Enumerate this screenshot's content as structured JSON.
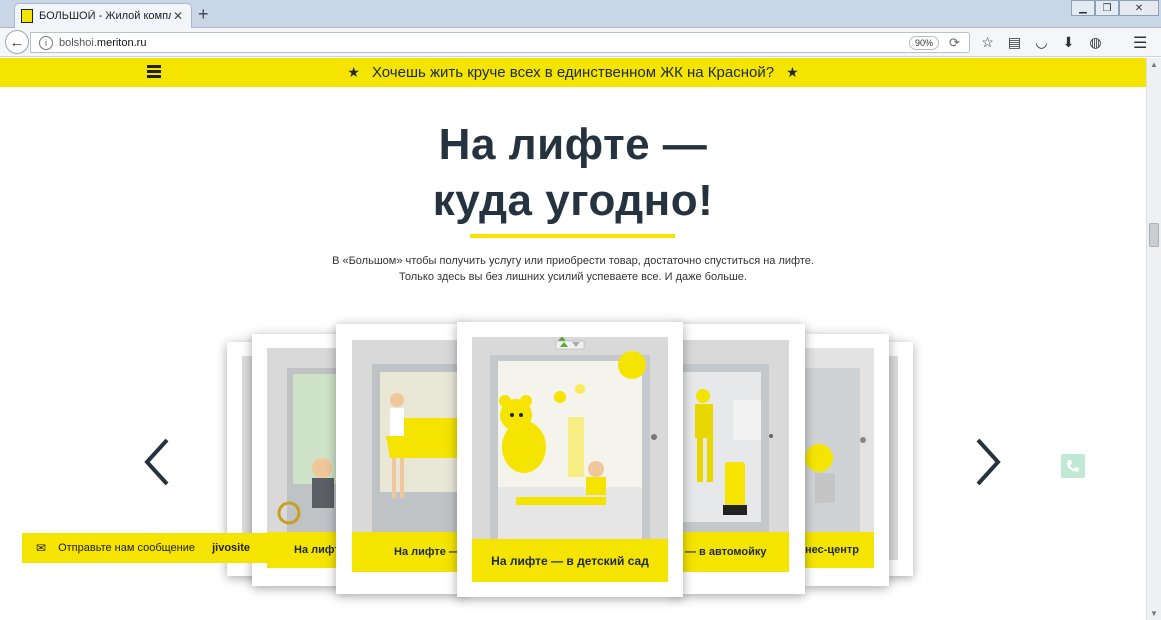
{
  "browser": {
    "tab_title": "БОЛЬШОЙ - Жилой компл€",
    "new_tab": "+",
    "url_host": "bolshoi.",
    "url_domain": "meriton.ru",
    "zoom": "90%"
  },
  "promo": {
    "text": "Хочешь жить круче всех в единственном ЖК на Красной?",
    "star": "★"
  },
  "hero": {
    "title_line1": "На лифте —",
    "title_line2": "куда угодно!",
    "subtitle_line1": "В «Большом» чтобы получить услугу или приобрести товар, достаточно спуститься на лифте.",
    "subtitle_line2": "Только здесь вы без лишних усилий успеваете все. И даже больше."
  },
  "carousel": {
    "cards": [
      {
        "label": ""
      },
      {
        "label": "На лифт"
      },
      {
        "label": "На лифте —"
      },
      {
        "label": "На лифте — в детский сад"
      },
      {
        "label": "— в автомойку"
      },
      {
        "label": "нес-центр"
      },
      {
        "label": ""
      }
    ]
  },
  "chat": {
    "text": "Отправьте нам сообщение",
    "brand": "jivosite"
  },
  "colors": {
    "brand_yellow": "#f5e400",
    "text_dark": "#24333f"
  }
}
